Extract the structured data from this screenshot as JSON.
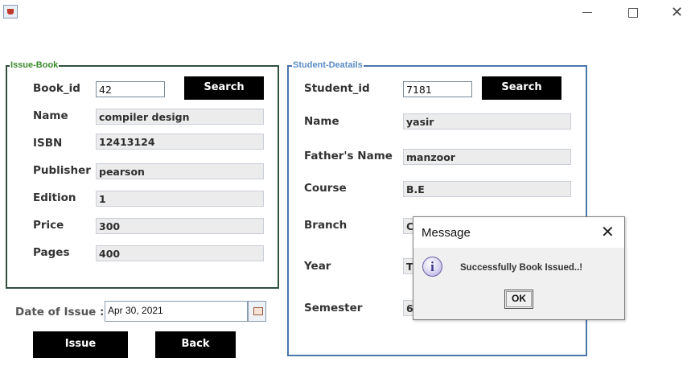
{
  "window": {
    "controls": [
      "minimize",
      "maximize",
      "close"
    ]
  },
  "issue_book": {
    "legend": "Issue-Book",
    "fields": [
      {
        "label": "Book_id",
        "value": "42"
      },
      {
        "label": "Name",
        "value": "compiler design"
      },
      {
        "label": "ISBN",
        "value": "12413124"
      },
      {
        "label": "Publisher",
        "value": "pearson"
      },
      {
        "label": "Edition",
        "value": "1"
      },
      {
        "label": "Price",
        "value": "300"
      },
      {
        "label": "Pages",
        "value": "400"
      }
    ],
    "search_label": "Search"
  },
  "student_details": {
    "legend": "Student-Deatails",
    "fields": [
      {
        "label": "Student_id",
        "value": "7181"
      },
      {
        "label": "Name",
        "value": "yasir"
      },
      {
        "label": "Father's Name",
        "value": "manzoor"
      },
      {
        "label": "Course",
        "value": "B.E"
      },
      {
        "label": "Branch",
        "value": "C"
      },
      {
        "label": "Year",
        "value": "T"
      },
      {
        "label": "Semester",
        "value": "6"
      }
    ],
    "search_label": "Search"
  },
  "date_of_issue": {
    "label": "Date of Issue :",
    "value": "Apr 30, 2021"
  },
  "actions": {
    "issue_label": "Issue",
    "back_label": "Back"
  },
  "dialog": {
    "title": "Message",
    "message": "Successfully Book Issued..!",
    "ok_label": "OK",
    "icon": "info-icon"
  }
}
